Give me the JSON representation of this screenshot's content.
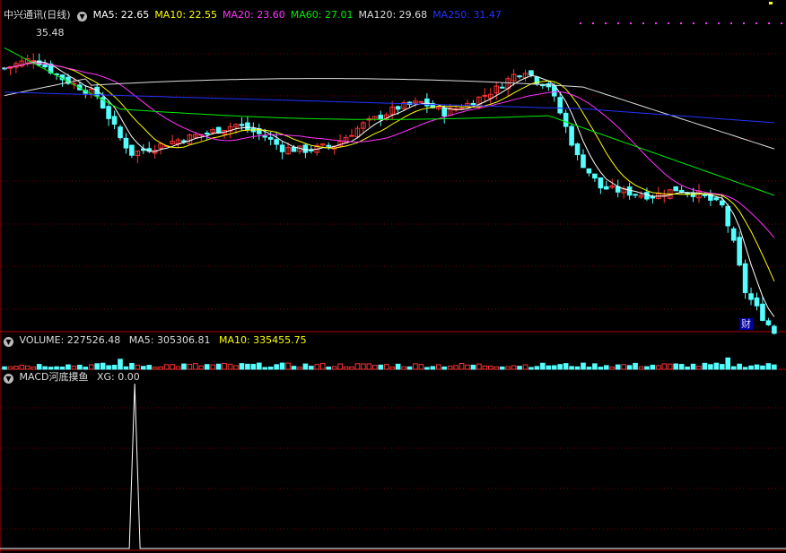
{
  "header": {
    "stock": "中兴通讯(日线)",
    "ma": [
      {
        "label": "MA5: 22.65",
        "color": "#ffffff"
      },
      {
        "label": "MA10: 22.55",
        "color": "#ffff00"
      },
      {
        "label": "MA20: 23.60",
        "color": "#ff33ff"
      },
      {
        "label": "MA60: 27.01",
        "color": "#00ee00"
      },
      {
        "label": "MA120: 29.68",
        "color": "#dddddd"
      },
      {
        "label": "MA250: 31.47",
        "color": "#2233ff"
      }
    ]
  },
  "volume_header": {
    "volume": "VOLUME: 227526.48",
    "ma5": "MA5: 305306.81",
    "ma10": "MA10: 335455.75"
  },
  "macd_header": {
    "name": "MACD河底摸鱼",
    "xg": "XG: 0.00"
  },
  "annotations": {
    "high_label": "35.48",
    "finance_badge": "财"
  },
  "colors": {
    "up": "#ff3333",
    "down": "#55ffff",
    "grid": "#7a0000",
    "separator": "#b00000"
  },
  "chart_data": [
    {
      "type": "candlestick",
      "title": "中兴通讯(日线)",
      "ylim": [
        18.5,
        36.5
      ],
      "annotation_high": 35.48,
      "ma_values": {
        "MA5": 22.65,
        "MA10": 22.55,
        "MA20": 23.6,
        "MA60": 27.01,
        "MA120": 29.68,
        "MA250": 31.47
      }
    },
    {
      "type": "bar",
      "title": "VOLUME",
      "values_summary": {
        "VOLUME": 227526.48,
        "MA5": 305306.81,
        "MA10": 335455.75
      }
    },
    {
      "type": "line",
      "title": "MACD河底摸鱼",
      "series": [
        {
          "name": "XG",
          "last": 0.0,
          "signal_bar_index": 25
        }
      ]
    }
  ]
}
